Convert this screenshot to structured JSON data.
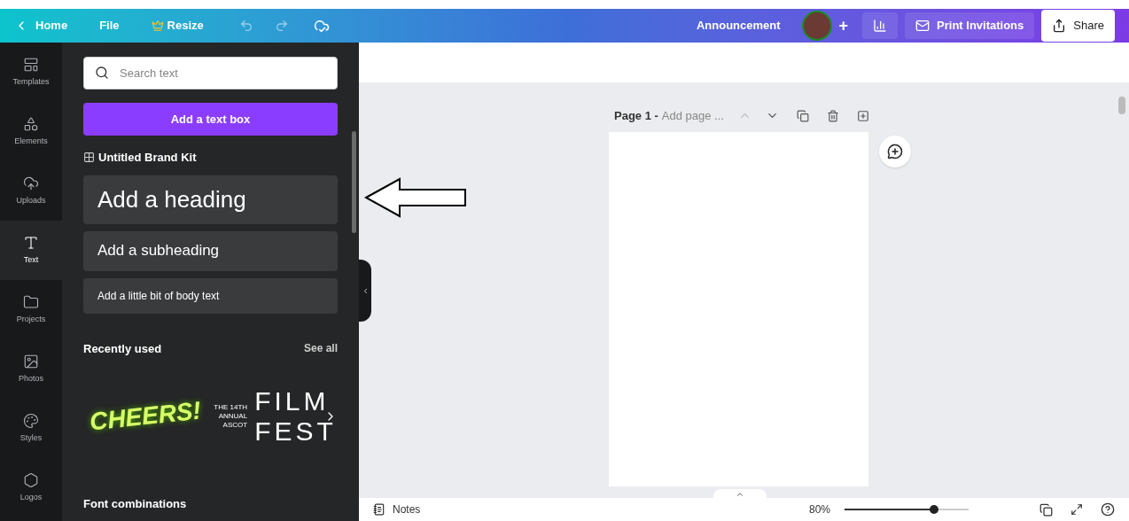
{
  "topbar": {
    "back": "Home",
    "menu": [
      "File"
    ],
    "resize": "Resize",
    "title": "Announcement",
    "add": "+",
    "print": "Print Invitations",
    "share": "Share"
  },
  "sidebar": {
    "items": [
      {
        "label": "Templates",
        "selected": false
      },
      {
        "label": "Elements",
        "selected": false
      },
      {
        "label": "Uploads",
        "selected": false
      },
      {
        "label": "Text",
        "selected": true
      },
      {
        "label": "Projects",
        "selected": false
      },
      {
        "label": "Photos",
        "selected": false
      },
      {
        "label": "Styles",
        "selected": false
      },
      {
        "label": "Logos",
        "selected": false
      }
    ]
  },
  "panel": {
    "search": {
      "placeholder": "Search text"
    },
    "add_button": "Add a text box",
    "brand_kit": "Untitled Brand Kit",
    "presets": [
      {
        "kind": "heading",
        "label": "Add a heading"
      },
      {
        "kind": "subheading",
        "label": "Add a subheading"
      },
      {
        "kind": "body",
        "label": "Add a little bit of body text"
      }
    ],
    "recent": {
      "title": "Recently used",
      "see_all": "See all",
      "items": [
        {
          "kind": "cheers",
          "text": "CHEERS!"
        },
        {
          "kind": "film",
          "small": "THE 14TH ANNUAL ASCOT",
          "line1": "FILM",
          "line2": "FEST"
        }
      ]
    },
    "font_combinations": "Font combinations"
  },
  "canvas": {
    "page_label": "Page 1 -",
    "page_title_placeholder": "Add page ...",
    "notes": "Notes",
    "zoom": "80%",
    "zoom_slider": {
      "level": 0.72
    }
  }
}
